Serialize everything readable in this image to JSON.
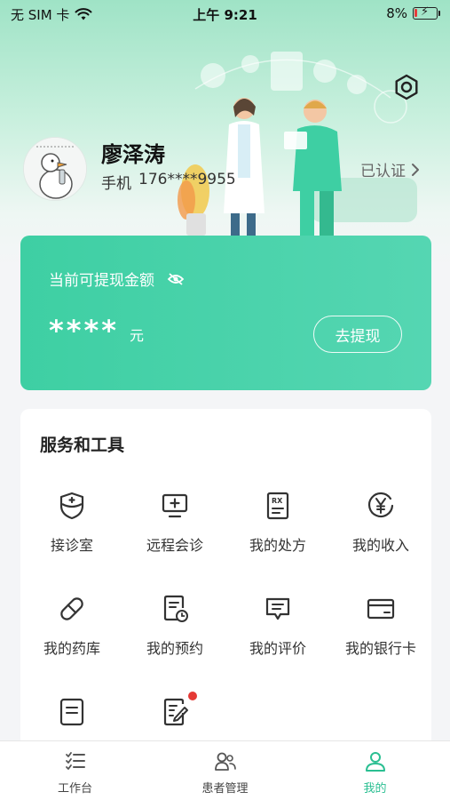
{
  "status_bar": {
    "carrier": "无 SIM 卡",
    "time": "上午 9:21",
    "battery": "8%"
  },
  "profile": {
    "name": "廖泽涛",
    "phone_label": "手机",
    "phone": "176****9955",
    "verify_status": "已认证"
  },
  "wallet": {
    "title": "当前可提现金额",
    "amount_masked": "****",
    "unit": "元",
    "withdraw_label": "去提现"
  },
  "services": {
    "title": "服务和工具",
    "items": [
      {
        "label": "接诊室",
        "icon": "shield-plus-icon"
      },
      {
        "label": "远程会诊",
        "icon": "monitor-plus-icon"
      },
      {
        "label": "我的处方",
        "icon": "prescription-icon"
      },
      {
        "label": "我的收入",
        "icon": "yen-coin-icon"
      },
      {
        "label": "我的药库",
        "icon": "pill-icon"
      },
      {
        "label": "我的预约",
        "icon": "appointment-icon"
      },
      {
        "label": "我的评价",
        "icon": "comment-icon"
      },
      {
        "label": "我的银行卡",
        "icon": "bank-card-icon"
      },
      {
        "label": "",
        "icon": "document-icon"
      },
      {
        "label": "",
        "icon": "edit-note-icon"
      }
    ]
  },
  "tabbar": {
    "items": [
      {
        "label": "工作台",
        "icon": "checklist-icon"
      },
      {
        "label": "患者管理",
        "icon": "patients-icon"
      },
      {
        "label": "我的",
        "icon": "user-icon"
      }
    ],
    "active_index": 2
  },
  "colors": {
    "accent": "#2bbf92",
    "wallet_start": "#3ecfa3",
    "wallet_end": "#55d6b2",
    "notification_dot": "#e53935"
  }
}
